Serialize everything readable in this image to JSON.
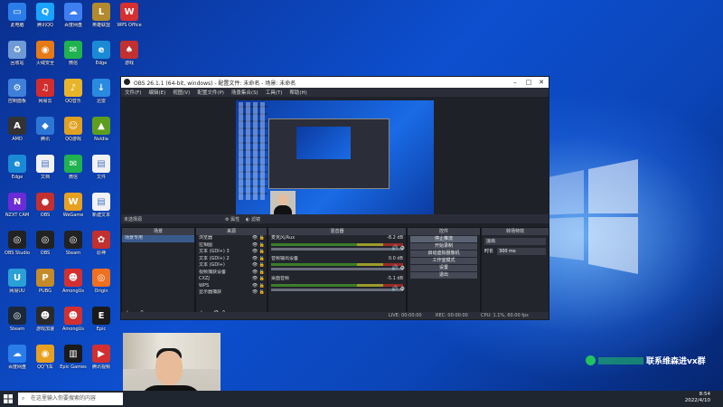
{
  "desktop_icons": [
    {
      "label": "此电脑",
      "color": "#2b7de9",
      "glyph": "▭",
      "col": 0,
      "row": 0
    },
    {
      "label": "腾讯QQ",
      "color": "#1aa3ff",
      "glyph": "Q",
      "col": 1,
      "row": 0
    },
    {
      "label": "百度网盘",
      "color": "#3d7ef0",
      "glyph": "☁",
      "col": 2,
      "row": 0
    },
    {
      "label": "英雄联盟",
      "color": "#b38a2d",
      "glyph": "L",
      "col": 3,
      "row": 0
    },
    {
      "label": "WPS Office",
      "color": "#d63030",
      "glyph": "W",
      "col": 4,
      "row": 0
    },
    {
      "label": "回收站",
      "color": "#6f9ad6",
      "glyph": "♻",
      "col": 0,
      "row": 1
    },
    {
      "label": "火绒安全",
      "color": "#e67a16",
      "glyph": "◉",
      "col": 1,
      "row": 1
    },
    {
      "label": "微信",
      "color": "#1fb24e",
      "glyph": "✉",
      "col": 2,
      "row": 1
    },
    {
      "label": "Edge",
      "color": "#1b8ad6",
      "glyph": "e",
      "col": 3,
      "row": 1
    },
    {
      "label": "游戏",
      "color": "#c23030",
      "glyph": "♠",
      "col": 4,
      "row": 1
    },
    {
      "label": "控制面板",
      "color": "#3f7fd9",
      "glyph": "⚙",
      "col": 0,
      "row": 2
    },
    {
      "label": "网易云",
      "color": "#d22d2d",
      "glyph": "♫",
      "col": 1,
      "row": 2
    },
    {
      "label": "QQ音乐",
      "color": "#e8b42a",
      "glyph": "♪",
      "col": 2,
      "row": 2
    },
    {
      "label": "迅雷",
      "color": "#2a8ae0",
      "glyph": "↓",
      "col": 3,
      "row": 2
    },
    {
      "label": "AMD",
      "color": "#333",
      "glyph": "A",
      "col": 0,
      "row": 3
    },
    {
      "label": "腾讯",
      "color": "#2c77d6",
      "glyph": "◆",
      "col": 1,
      "row": 3
    },
    {
      "label": "QQ游戏",
      "color": "#e0a020",
      "glyph": "☺",
      "col": 2,
      "row": 3
    },
    {
      "label": "Nvidia",
      "color": "#5e9e1e",
      "glyph": "▲",
      "col": 3,
      "row": 3
    },
    {
      "label": "Edge",
      "color": "#1b8ad6",
      "glyph": "e",
      "col": 0,
      "row": 4
    },
    {
      "label": "文档",
      "color": "#f2f2f2",
      "glyph": "▤",
      "col": 1,
      "row": 4
    },
    {
      "label": "微信",
      "color": "#1fb24e",
      "glyph": "✉",
      "col": 2,
      "row": 4
    },
    {
      "label": "文件",
      "color": "#f2f2f2",
      "glyph": "▤",
      "col": 3,
      "row": 4
    },
    {
      "label": "NZXT CAM",
      "color": "#6b2bd6",
      "glyph": "N",
      "col": 0,
      "row": 5
    },
    {
      "label": "OBS",
      "color": "#c23030",
      "glyph": "●",
      "col": 1,
      "row": 5
    },
    {
      "label": "WeGame",
      "color": "#e8a020",
      "glyph": "W",
      "col": 2,
      "row": 5
    },
    {
      "label": "新建文本",
      "color": "#f2f2f2",
      "glyph": "▤",
      "col": 3,
      "row": 5
    },
    {
      "label": "OBS Studio",
      "color": "#222",
      "glyph": "◎",
      "col": 0,
      "row": 6
    },
    {
      "label": "OBS",
      "color": "#222",
      "glyph": "◎",
      "col": 1,
      "row": 6
    },
    {
      "label": "Steam",
      "color": "#222",
      "glyph": "◎",
      "col": 2,
      "row": 6
    },
    {
      "label": "原神",
      "color": "#c23030",
      "glyph": "✿",
      "col": 3,
      "row": 6
    },
    {
      "label": "网易UU",
      "color": "#2aa0d6",
      "glyph": "U",
      "col": 0,
      "row": 7
    },
    {
      "label": "PUBG",
      "color": "#c58a2a",
      "glyph": "P",
      "col": 1,
      "row": 7
    },
    {
      "label": "AmongUs",
      "color": "#d23030",
      "glyph": "☻",
      "col": 2,
      "row": 7
    },
    {
      "label": "Origin",
      "color": "#f07020",
      "glyph": "◎",
      "col": 3,
      "row": 7
    },
    {
      "label": "Steam",
      "color": "#1b2838",
      "glyph": "◎",
      "col": 0,
      "row": 8
    },
    {
      "label": "游戏加速",
      "color": "#2a2a2a",
      "glyph": "☻",
      "col": 1,
      "row": 8
    },
    {
      "label": "AmongUs",
      "color": "#d23030",
      "glyph": "☻",
      "col": 2,
      "row": 8
    },
    {
      "label": "Epic",
      "color": "#1a1a1a",
      "glyph": "E",
      "col": 3,
      "row": 8
    },
    {
      "label": "百度网盘",
      "color": "#2a7de9",
      "glyph": "☁",
      "col": 0,
      "row": 9
    },
    {
      "label": "QQ飞车",
      "color": "#e8a020",
      "glyph": "◉",
      "col": 1,
      "row": 9
    },
    {
      "label": "Epic Games",
      "color": "#1a1a1a",
      "glyph": "▥",
      "col": 2,
      "row": 9
    },
    {
      "label": "腾讯视频",
      "color": "#d23030",
      "glyph": "▶",
      "col": 3,
      "row": 9
    }
  ],
  "obs": {
    "title": "OBS 26.1.1 (64-bit, windows) - 配置文件: 未命名 - 场景: 未命名",
    "menu": [
      "文件(F)",
      "编辑(E)",
      "视图(V)",
      "配置文件(P)",
      "场景集合(S)",
      "工具(T)",
      "帮助(H)"
    ],
    "no_source": "未选择源",
    "props_label": "属性",
    "filters_label": "滤镜",
    "docks": {
      "scenes": {
        "title": "场景",
        "items": [
          "场景专用"
        ]
      },
      "sources": {
        "title": "来源",
        "items": [
          "浏览器",
          "拉相图",
          "文本 (GDI+) 3",
          "文本 (GDI+) 2",
          "文本 (GDI+)",
          "视频捕获设备",
          "CXZJ",
          "WPS",
          "显示器捕获"
        ]
      },
      "mixer": {
        "title": "混音器",
        "channels": [
          {
            "name": "麦克风/Aux",
            "db": "-8.2 dB"
          },
          {
            "name": "音频输出设备",
            "db": "0.0 dB"
          },
          {
            "name": "桌面音频",
            "db": "-5.1 dB"
          }
        ]
      },
      "controls": {
        "title": "控件",
        "buttons": [
          "停止推流",
          "开始录制",
          "启动虚拟摄像机",
          "工作室模式",
          "设置",
          "退出"
        ]
      },
      "transitions": {
        "title": "转场特效",
        "mode": "淡出",
        "duration_label": "时长",
        "duration": "300 ms"
      }
    },
    "status": {
      "live": "LIVE: 00:00:00",
      "rec": "REC: 00:00:00",
      "cpu": "CPU: 1.1%, 60.00 fps"
    }
  },
  "overlay": {
    "wechat_text": "联系维森进vx群"
  },
  "taskbar": {
    "search_placeholder": "在这里输入你要搜索的内容",
    "time": "8:54",
    "date": "2022/4/10"
  }
}
